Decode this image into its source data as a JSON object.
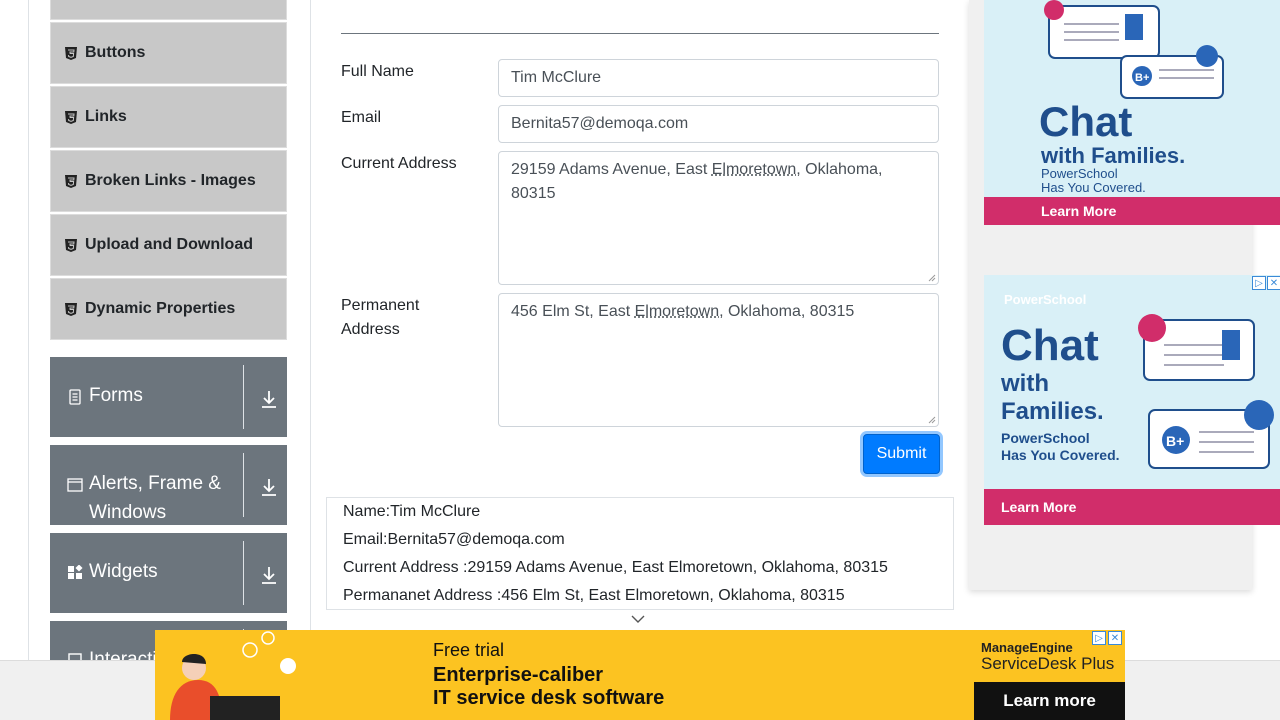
{
  "sidebar": {
    "items": [
      {
        "label": "Buttons"
      },
      {
        "label": "Links"
      },
      {
        "label": "Broken Links - Images"
      },
      {
        "label": "Upload and Download"
      },
      {
        "label": "Dynamic Properties"
      }
    ],
    "groups": [
      {
        "label": "Forms"
      },
      {
        "label": "Alerts, Frame & Windows"
      },
      {
        "label": "Widgets"
      },
      {
        "label": "Interactions"
      }
    ]
  },
  "form": {
    "full_name_label": "Full Name",
    "full_name_value": "Tim McClure",
    "email_label": "Email",
    "email_value": "Bernita57@demoqa.com",
    "current_address_label": "Current Address",
    "current_address_pre": "29159 Adams Avenue, East ",
    "current_address_city": "Elmoretown",
    "current_address_post": ", Oklahoma, 80315",
    "permanent_address_label": "Permanent Address",
    "permanent_address_pre": "456 Elm St, East ",
    "permanent_address_city": "Elmoretown",
    "permanent_address_post": ", Oklahoma, 80315",
    "submit_label": "Submit"
  },
  "output": {
    "name": "Name:Tim McClure",
    "email": "Email:Bernita57@demoqa.com",
    "current_address": "Current Address :29159 Adams Avenue, East Elmoretown, Oklahoma, 80315",
    "permanent_address": "Permananet Address :456 Elm St, East Elmoretown, Oklahoma, 80315"
  },
  "ads": {
    "right_top": {
      "headline": "Chat",
      "sub": "with Families.",
      "tag1": "PowerSchool",
      "tag2": "Has You Covered.",
      "cta": "Learn More"
    },
    "right_mid": {
      "brand": "PowerSchool",
      "headline": "Chat",
      "sub1": "with",
      "sub2": "Families.",
      "tag1": "PowerSchool",
      "tag2": "Has You Covered.",
      "cta": "Learn More"
    },
    "bottom": {
      "line1": "Free trial",
      "line2": "Enterprise-caliber",
      "line3": "IT service desk software",
      "brand1": "ManageEngine",
      "brand2": "ServiceDesk Plus",
      "cta": "Learn more"
    }
  },
  "colors": {
    "accent": "#007bff",
    "group_bg": "#6c757d",
    "subitem_bg": "#c8c8c8",
    "ad_pink": "#d12d6a",
    "ad_yellow": "#fcc321"
  }
}
